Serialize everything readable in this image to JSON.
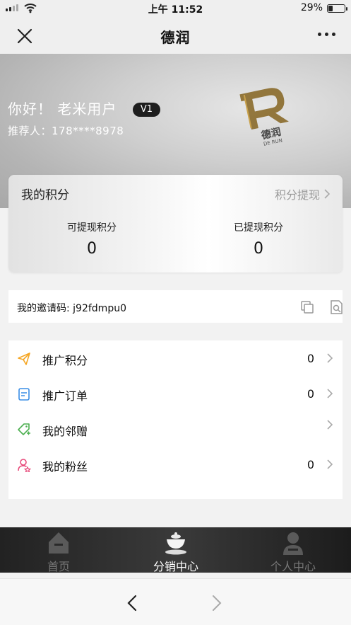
{
  "status_bar": {
    "time": "上午 11:52",
    "battery": "29%",
    "battery_level": 0.29
  },
  "nav": {
    "title": "德润"
  },
  "hero": {
    "greeting": "你好！ 老米用户",
    "level": "V1",
    "referrer": "推荐人：178****8978",
    "brand_logo_text": "德润",
    "brand_logo_sub": "DE RUN"
  },
  "points": {
    "title": "我的积分",
    "withdraw_link": "积分提现",
    "withdrawable_label": "可提现积分",
    "withdrawable_value": "0",
    "withdrawn_label": "已提现积分",
    "withdrawn_value": "0"
  },
  "invite": {
    "text": "我的邀请码: j92fdmpu0"
  },
  "menu": [
    {
      "label": "推广积分",
      "count": "0",
      "icon": "paper-plane-icon",
      "color": "#f5a623"
    },
    {
      "label": "推广订单",
      "count": "0",
      "icon": "order-doc-icon",
      "color": "#3a8ee6"
    },
    {
      "label": "我的邻赠",
      "count": "",
      "icon": "gift-tag-icon",
      "color": "#4caf50"
    },
    {
      "label": "我的粉丝",
      "count": "0",
      "icon": "fan-user-icon",
      "color": "#e84a7a"
    }
  ],
  "tabs": [
    {
      "label": "首页",
      "icon": "home-icon",
      "active": false
    },
    {
      "label": "分销中心",
      "icon": "tea-cup-icon",
      "active": true
    },
    {
      "label": "个人中心",
      "icon": "person-icon",
      "active": false
    }
  ],
  "colors": {
    "accent_dark": "#1e1e1e",
    "muted_text": "#9a9a9a"
  }
}
